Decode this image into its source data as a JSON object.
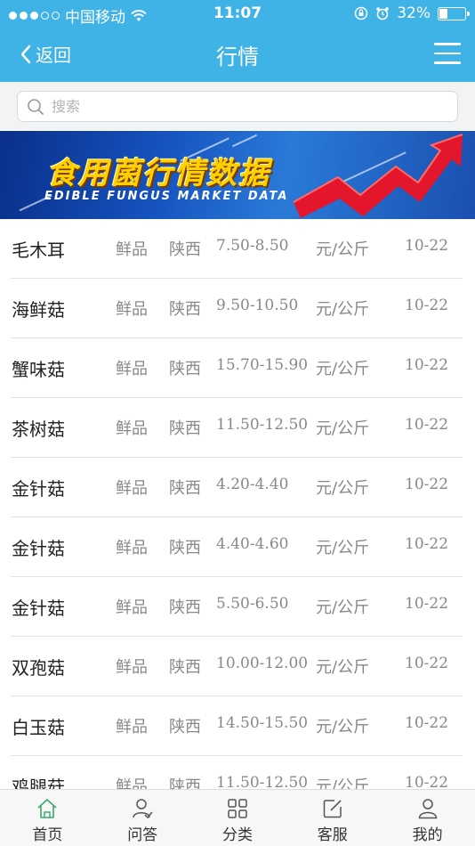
{
  "status": {
    "carrier": "中国移动",
    "time": "11:07",
    "battery": "32%",
    "battery_level": 0.32
  },
  "nav": {
    "back_label": "返回",
    "title": "行情"
  },
  "search": {
    "placeholder": "搜索"
  },
  "banner": {
    "title": "食用菌行情数据",
    "subtitle": "EDIBLE FUNGUS MARKET DATA"
  },
  "rows": [
    {
      "name": "毛木耳",
      "kind": "鲜品",
      "origin": "陕西",
      "price": "7.50-8.50",
      "unit": "元/公斤",
      "date": "10-22"
    },
    {
      "name": "海鲜菇",
      "kind": "鲜品",
      "origin": "陕西",
      "price": "9.50-10.50",
      "unit": "元/公斤",
      "date": "10-22"
    },
    {
      "name": "蟹味菇",
      "kind": "鲜品",
      "origin": "陕西",
      "price": "15.70-15.90",
      "unit": "元/公斤",
      "date": "10-22"
    },
    {
      "name": "茶树菇",
      "kind": "鲜品",
      "origin": "陕西",
      "price": "11.50-12.50",
      "unit": "元/公斤",
      "date": "10-22"
    },
    {
      "name": "金针菇",
      "kind": "鲜品",
      "origin": "陕西",
      "price": "4.20-4.40",
      "unit": "元/公斤",
      "date": "10-22"
    },
    {
      "name": "金针菇",
      "kind": "鲜品",
      "origin": "陕西",
      "price": "4.40-4.60",
      "unit": "元/公斤",
      "date": "10-22"
    },
    {
      "name": "金针菇",
      "kind": "鲜品",
      "origin": "陕西",
      "price": "5.50-6.50",
      "unit": "元/公斤",
      "date": "10-22"
    },
    {
      "name": "双孢菇",
      "kind": "鲜品",
      "origin": "陕西",
      "price": "10.00-12.00",
      "unit": "元/公斤",
      "date": "10-22"
    },
    {
      "name": "白玉菇",
      "kind": "鲜品",
      "origin": "陕西",
      "price": "14.50-15.50",
      "unit": "元/公斤",
      "date": "10-22"
    },
    {
      "name": "鸡腿菇",
      "kind": "鲜品",
      "origin": "陕西",
      "price": "11.50-12.50",
      "unit": "元/公斤",
      "date": "10-22"
    }
  ],
  "tabs": [
    {
      "label": "首页",
      "icon": "home-icon",
      "active": true
    },
    {
      "label": "问答",
      "icon": "user-check-icon"
    },
    {
      "label": "分类",
      "icon": "grid-icon"
    },
    {
      "label": "客服",
      "icon": "edit-icon"
    },
    {
      "label": "我的",
      "icon": "user-icon"
    }
  ],
  "colors": {
    "header": "#3fb2e6",
    "active_tab_icon": "#3aa86b"
  }
}
